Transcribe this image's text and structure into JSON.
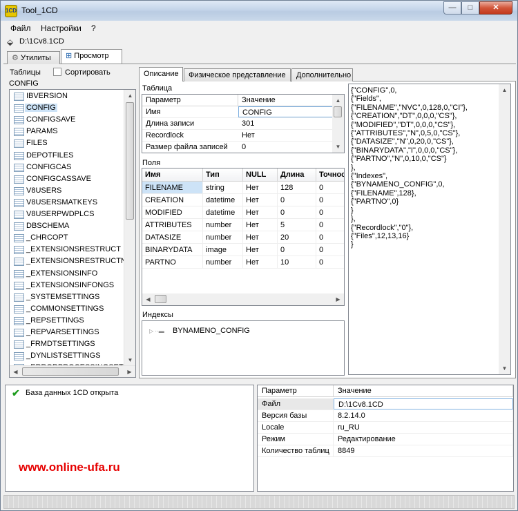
{
  "window": {
    "title": "Tool_1CD",
    "app_icon_text": "1CD",
    "min_glyph": "—",
    "max_glyph": "□",
    "close_glyph": "✕"
  },
  "menu": [
    "Файл",
    "Настройки",
    "?"
  ],
  "path": "D:\\1Cv8.1CD",
  "outer_tabs": {
    "utils": "Утилиты",
    "view": "Просмотр"
  },
  "left": {
    "tables_label": "Таблицы",
    "sort_label": "Сортировать",
    "selected_name": "CONFIG",
    "tables": [
      "IBVERSION",
      "CONFIG",
      "CONFIGSAVE",
      "PARAMS",
      "FILES",
      "DEPOTFILES",
      "CONFIGCAS",
      "CONFIGCASSAVE",
      "V8USERS",
      "V8USERSMATKEYS",
      "V8USERPWDPLCS",
      "DBSCHEMA",
      "_CHRCOPT",
      "_EXTENSIONSRESTRUCT",
      "_EXTENSIONSRESTRUCTN",
      "_EXTENSIONSINFO",
      "_EXTENSIONSINFONGS",
      "_SYSTEMSETTINGS",
      "_COMMONSETTINGS",
      "_REPSETTINGS",
      "_REPVARSETTINGS",
      "_FRMDTSETTINGS",
      "_DYNLISTSETTINGS",
      "_ERRORPROCESSINGSETT"
    ]
  },
  "inner_tabs": {
    "desc": "Описание",
    "phys": "Физическое представление",
    "extra": "Дополнительно"
  },
  "table_group": {
    "label": "Таблица",
    "headers": {
      "param": "Параметр",
      "value": "Значение"
    },
    "rows": [
      {
        "param": "Имя",
        "value": "CONFIG"
      },
      {
        "param": "Длина записи",
        "value": "301"
      },
      {
        "param": "Recordlock",
        "value": "Нет"
      },
      {
        "param": "Размер файла записей",
        "value": "0"
      }
    ]
  },
  "fields_group": {
    "label": "Поля",
    "headers": {
      "name": "Имя",
      "type": "Тип",
      "null": "NULL",
      "length": "Длина",
      "precision": "Точнос"
    },
    "rows": [
      {
        "name": "FILENAME",
        "type": "string",
        "null": "Нет",
        "length": "128",
        "precision": "0"
      },
      {
        "name": "CREATION",
        "type": "datetime",
        "null": "Нет",
        "length": "0",
        "precision": "0"
      },
      {
        "name": "MODIFIED",
        "type": "datetime",
        "null": "Нет",
        "length": "0",
        "precision": "0"
      },
      {
        "name": "ATTRIBUTES",
        "type": "number",
        "null": "Нет",
        "length": "5",
        "precision": "0"
      },
      {
        "name": "DATASIZE",
        "type": "number",
        "null": "Нет",
        "length": "20",
        "precision": "0"
      },
      {
        "name": "BINARYDATA",
        "type": "image",
        "null": "Нет",
        "length": "0",
        "precision": "0"
      },
      {
        "name": "PARTNO",
        "type": "number",
        "null": "Нет",
        "length": "10",
        "precision": "0"
      }
    ]
  },
  "index_group": {
    "label": "Индексы",
    "items": [
      "BYNAMENO_CONFIG"
    ]
  },
  "json_text": "{\"CONFIG\",0,\n{\"Fields\",\n{\"FILENAME\",\"NVC\",0,128,0,\"CI\"},\n{\"CREATION\",\"DT\",0,0,0,\"CS\"},\n{\"MODIFIED\",\"DT\",0,0,0,\"CS\"},\n{\"ATTRIBUTES\",\"N\",0,5,0,\"CS\"},\n{\"DATASIZE\",\"N\",0,20,0,\"CS\"},\n{\"BINARYDATA\",\"I\",0,0,0,\"CS\"},\n{\"PARTNO\",\"N\",0,10,0,\"CS\"}\n},\n{\"Indexes\",\n{\"BYNAMENO_CONFIG\",0,\n{\"FILENAME\",128},\n{\"PARTNO\",0}\n}\n},\n{\"Recordlock\",\"0\"},\n{\"Files\",12,13,16}\n}",
  "status": {
    "message": "База данных 1CD открыта",
    "icon": "check-icon"
  },
  "watermark": "www.online-ufa.ru",
  "info_grid": {
    "headers": {
      "param": "Параметр",
      "value": "Значение"
    },
    "rows": [
      {
        "param": "Файл",
        "value": "D:\\1Cv8.1CD"
      },
      {
        "param": "Версия базы",
        "value": "8.2.14.0"
      },
      {
        "param": "Locale",
        "value": "ru_RU"
      },
      {
        "param": "Режим",
        "value": "Редактирование"
      },
      {
        "param": "Количество таблиц",
        "value": "8849"
      }
    ]
  },
  "colors": {
    "selection": "#cde3f7",
    "watermark": "#e60000",
    "status_check": "#1e9c1e"
  }
}
